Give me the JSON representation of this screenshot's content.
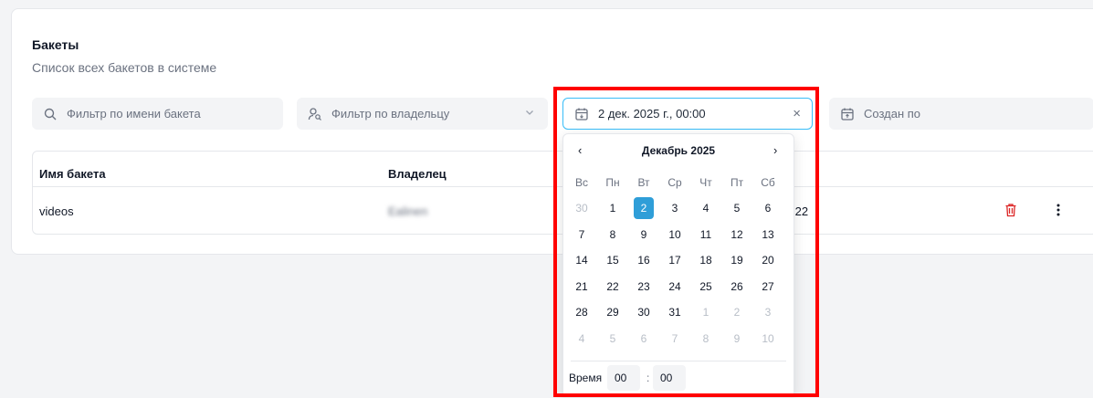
{
  "page": {
    "title": "Бакеты",
    "subtitle": "Список всех бакетов в системе"
  },
  "filters": {
    "name_placeholder": "Фильтр по имени бакета",
    "owner_placeholder": "Фильтр по владельцу",
    "created_from_value": "2 дек. 2025 г., 00:00",
    "clear_symbol": "×",
    "created_to_placeholder": "Создан по"
  },
  "table": {
    "headers": [
      "Имя бакета",
      "Владелец"
    ],
    "rows": [
      {
        "name": "videos",
        "owner": "Ealinen",
        "created_fragment": ":22"
      }
    ]
  },
  "datepicker": {
    "prev": "‹",
    "next": "›",
    "month_label": "Декабрь 2025",
    "weekdays": [
      "Вс",
      "Пн",
      "Вт",
      "Ср",
      "Чт",
      "Пт",
      "Сб"
    ],
    "weeks": [
      [
        {
          "d": "30",
          "m": true
        },
        {
          "d": "1"
        },
        {
          "d": "2",
          "sel": true
        },
        {
          "d": "3"
        },
        {
          "d": "4"
        },
        {
          "d": "5"
        },
        {
          "d": "6"
        }
      ],
      [
        {
          "d": "7"
        },
        {
          "d": "8"
        },
        {
          "d": "9"
        },
        {
          "d": "10"
        },
        {
          "d": "11"
        },
        {
          "d": "12"
        },
        {
          "d": "13"
        }
      ],
      [
        {
          "d": "14"
        },
        {
          "d": "15"
        },
        {
          "d": "16"
        },
        {
          "d": "17"
        },
        {
          "d": "18"
        },
        {
          "d": "19"
        },
        {
          "d": "20"
        }
      ],
      [
        {
          "d": "21"
        },
        {
          "d": "22"
        },
        {
          "d": "23"
        },
        {
          "d": "24"
        },
        {
          "d": "25"
        },
        {
          "d": "26"
        },
        {
          "d": "27"
        }
      ],
      [
        {
          "d": "28"
        },
        {
          "d": "29"
        },
        {
          "d": "30"
        },
        {
          "d": "31"
        },
        {
          "d": "1",
          "m": true
        },
        {
          "d": "2",
          "m": true
        },
        {
          "d": "3",
          "m": true
        }
      ],
      [
        {
          "d": "4",
          "m": true
        },
        {
          "d": "5",
          "m": true
        },
        {
          "d": "6",
          "m": true
        },
        {
          "d": "7",
          "m": true
        },
        {
          "d": "8",
          "m": true
        },
        {
          "d": "9",
          "m": true
        },
        {
          "d": "10",
          "m": true
        }
      ]
    ],
    "time_label": "Время",
    "hours": "00",
    "time_separator": ":",
    "minutes": "00"
  },
  "colors": {
    "accent": "#2f9ed8",
    "focus_border": "#38bdf8",
    "delete_icon": "#dc2626",
    "annotation": "#ff0000"
  },
  "icons": [
    "search-icon",
    "user-search-icon",
    "chevron-down-icon",
    "calendar-icon",
    "close-icon",
    "trash-icon",
    "more-vertical-icon"
  ]
}
